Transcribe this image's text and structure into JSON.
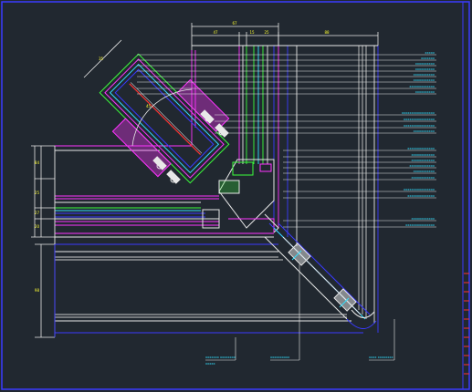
{
  "viewport": {
    "title": "",
    "background": "#212830"
  },
  "dimensions": {
    "top": [
      "47",
      "15",
      "25",
      "88"
    ],
    "top_overall": "67",
    "left": [
      "84",
      "25",
      "27",
      "20"
    ],
    "left_lower": "98",
    "angle": "45",
    "slant": "35"
  },
  "right_callouts": [
    "xxxxx",
    "xxxxxxx",
    "xxxxxxxxxx",
    "xxxxxxxxxx",
    "xxxxxxxxxxx",
    "xxxxxxxxxxx",
    "xxxxxxxxxxxxx",
    "xxxxxxxxxx",
    "xxxxxxxxxxxxxxxxx",
    "xxxxxxxxxxxxxxxx",
    "xxxxxxxxxxxxxxxx",
    "xxxxxxxxxxx",
    "xxxxxxxxxxxxxx",
    "xxxxxxxxxxxx",
    "xxxxxxxxxxxx",
    "xxxxxxxxxxxxx",
    "xxxxxxxxxxx",
    "xxxxxxxxxxxx",
    "xxxxxxxxxxxxxxxx",
    "xxxxxxxxxxxxxx",
    "xxxxxxxxxxxx",
    "xxxxxxxxxxxxxxx"
  ],
  "bottom_callouts": [
    {
      "line1": "xxxxxxx xxxxxxxx",
      "line2": "xxxxx"
    },
    {
      "line1": "xxxxxxxxxx",
      "line2": ""
    },
    {
      "line1": "xxxx xxxxxxxx",
      "line2": ""
    }
  ],
  "colors": {
    "outline": "#3a3aff",
    "cyan": "#33e0ff",
    "green": "#3cff3c",
    "magenta": "#ff33ff",
    "yellow": "#ffff33",
    "red": "#ff3333",
    "white": "#e8e8e8",
    "gray": "#c8c8c8"
  }
}
